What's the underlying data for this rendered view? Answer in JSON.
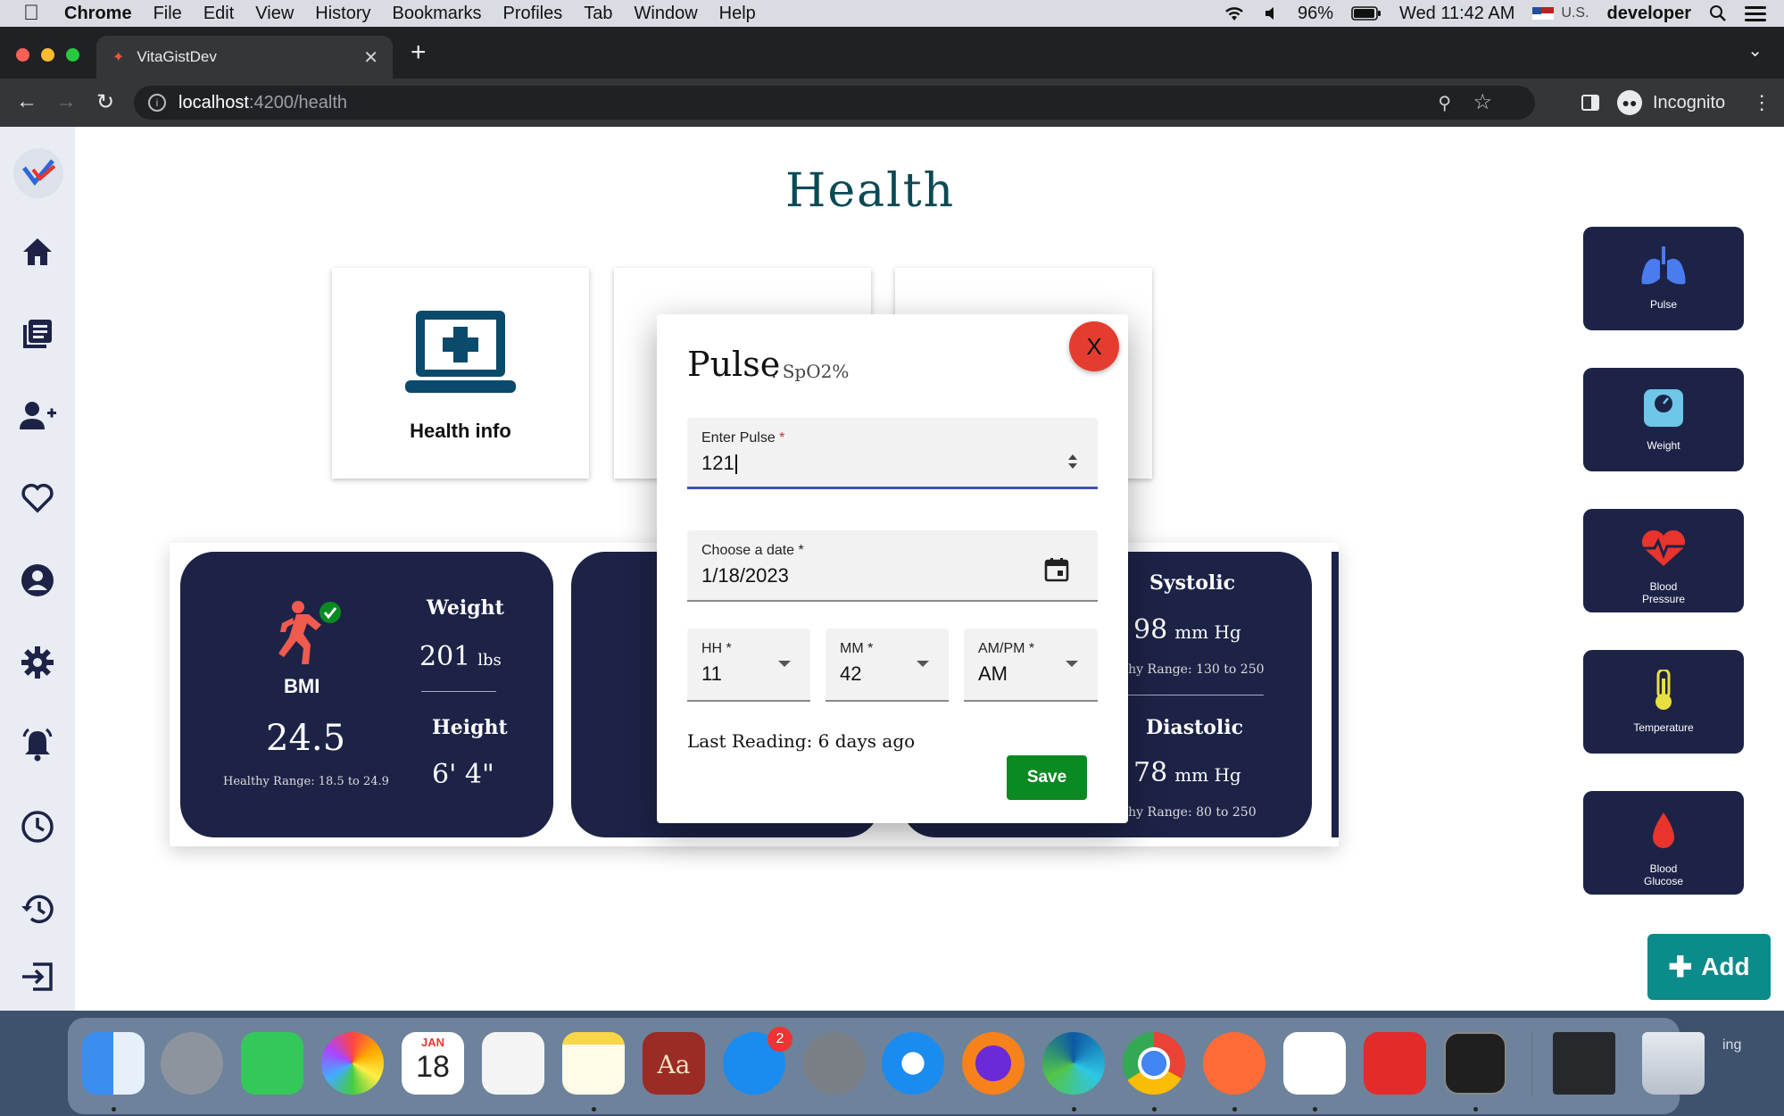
{
  "menubar": {
    "app": "Chrome",
    "items": [
      "File",
      "Edit",
      "View",
      "History",
      "Bookmarks",
      "Profiles",
      "Tab",
      "Window",
      "Help"
    ],
    "battery": "96%",
    "clock": "Wed 11:42 AM",
    "input_source": "U.S.",
    "user": "developer"
  },
  "browser": {
    "tab_title": "VitaGistDev",
    "url_host": "localhost",
    "url_path": ":4200/health",
    "profile_label": "Incognito"
  },
  "page": {
    "title": "Health",
    "cards": [
      {
        "label": "Health info"
      }
    ]
  },
  "bmi_card": {
    "label": "BMI",
    "value": "24.5",
    "range": "Healthy Range: 18.5 to 24.9",
    "weight_label": "Weight",
    "weight_value": "201",
    "weight_unit": "lbs",
    "height_label": "Height",
    "height_value": "6' 4\""
  },
  "bp_card": {
    "systolic_label": "Systolic",
    "systolic_value": "98",
    "systolic_unit": "mm Hg",
    "systolic_range": "lthy Range: 130 to 250",
    "diastolic_label": "Diastolic",
    "diastolic_value": "78",
    "diastolic_unit": "mm Hg",
    "diastolic_range": "lthy Range: 80 to 250"
  },
  "quick_actions": [
    {
      "label": "Pulse",
      "icon": "lungs-icon",
      "color": "#4a7cf0"
    },
    {
      "label": "Weight",
      "icon": "scale-icon",
      "color": "#6ec6e8"
    },
    {
      "label": "Blood Pressure",
      "icon": "heart-pulse-icon",
      "color": "#e8342c"
    },
    {
      "label": "Temperature",
      "icon": "thermometer-icon",
      "color": "#e8e040"
    },
    {
      "label": "Blood Glucose",
      "icon": "blood-drop-icon",
      "color": "#e8342c"
    }
  ],
  "add_button": "Add",
  "modal": {
    "title": "Pulse",
    "subtitle": ". SpO2%",
    "close_label": "X",
    "pulse_field": {
      "label": "Enter Pulse",
      "required": "*",
      "value": "121"
    },
    "date_field": {
      "label": "Choose a date *",
      "value": "1/18/2023"
    },
    "hh_field": {
      "label": "HH *",
      "value": "11"
    },
    "mm_field": {
      "label": "MM *",
      "value": "42"
    },
    "ampm_field": {
      "label": "AM/PM *",
      "value": "AM"
    },
    "last_reading": "Last Reading: 6 days ago",
    "save_label": "Save"
  },
  "dock": {
    "calendar_month": "JAN",
    "calendar_day": "18",
    "appstore_badge": "2",
    "dictionary_text": "Aa",
    "overflow_label": "ing"
  }
}
